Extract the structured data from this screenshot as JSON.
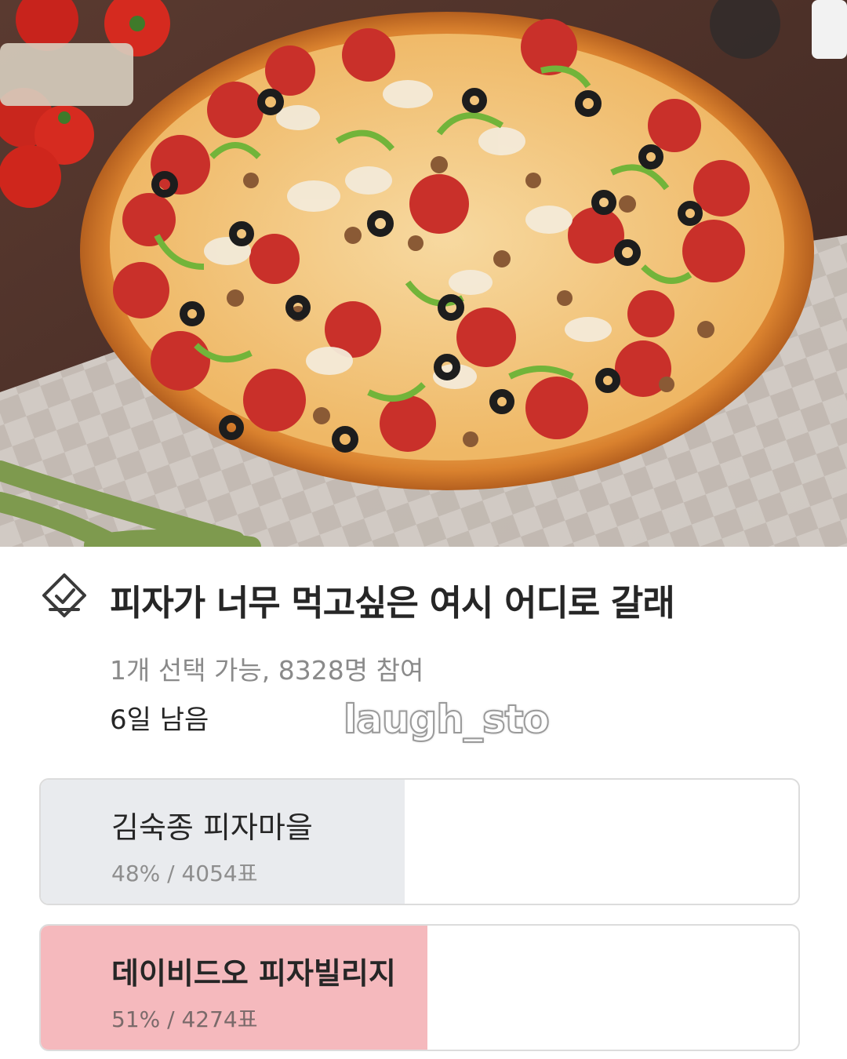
{
  "poll": {
    "title": "피자가 너무 먹고싶은 여시 어디로 갈래",
    "meta": "1개 선택 가능, 8328명 참여",
    "remaining": "6일 남음",
    "icon": "checkmark-diamond-icon"
  },
  "watermark": "laugh_sto",
  "options": [
    {
      "label": "김숙종 피자마을",
      "stats": "48% / 4054표",
      "fraction": 0.48,
      "selected": false,
      "fill_color": "#e9ebee"
    },
    {
      "label": "데이비드오 피자빌리지",
      "stats": "51% / 4274표",
      "fraction": 0.51,
      "selected": true,
      "fill_color": "#f5b9bd"
    }
  ],
  "colors": {
    "border": "#dcdcdc",
    "text_primary": "#262626",
    "text_secondary": "#8a8a8a"
  }
}
